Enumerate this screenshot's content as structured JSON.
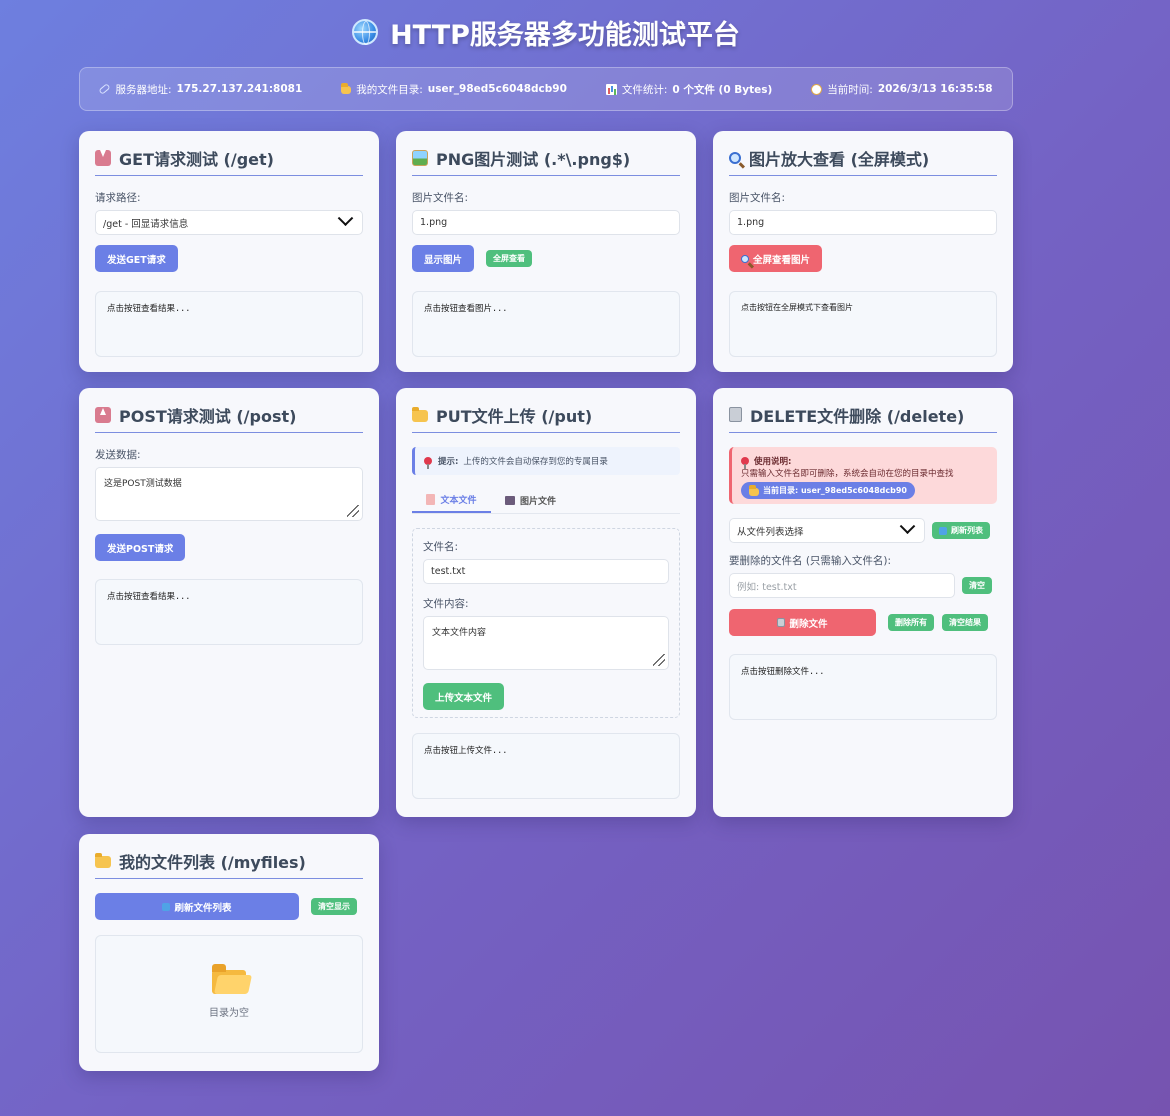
{
  "page_title": "HTTP服务器多功能测试平台",
  "info": {
    "server_label": "服务器地址:",
    "server_value": "175.27.137.241:8081",
    "dir_label": "我的文件目录:",
    "dir_value": "user_98ed5c6048dcb90",
    "stats_label": "文件统计:",
    "stats_value": "0 个文件 (0 Bytes)",
    "time_label": "当前时间:",
    "time_value": "2026/3/13 16:35:58"
  },
  "get_card": {
    "title": "GET请求测试 (/get)",
    "path_label": "请求路径:",
    "path_selected": "/get - 回显请求信息",
    "send_button": "发送GET请求",
    "result": "点击按钮查看结果..."
  },
  "png_card": {
    "title": "PNG图片测试 (.*\\.png$)",
    "file_label": "图片文件名:",
    "file_value": "1.png",
    "show_button": "显示图片",
    "fullscreen_button": "全屏查看",
    "result": "点击按钮查看图片..."
  },
  "zoom_card": {
    "title": "图片放大查看 (全屏模式)",
    "file_label": "图片文件名:",
    "file_value": "1.png",
    "fullscreen_button": "全屏查看图片",
    "result": "点击按钮在全屏模式下查看图片"
  },
  "post_card": {
    "title": "POST请求测试 (/post)",
    "data_label": "发送数据:",
    "data_value": "这是POST测试数据",
    "send_button": "发送POST请求",
    "result": "点击按钮查看结果..."
  },
  "put_card": {
    "title": "PUT文件上传 (/put)",
    "hint_label": "提示:",
    "hint_text": "上传的文件会自动保存到您的专属目录",
    "tab_text": "文本文件",
    "tab_image": "图片文件",
    "filename_label": "文件名:",
    "filename_value": "test.txt",
    "content_label": "文件内容:",
    "content_value": "文本文件内容",
    "upload_button": "上传文本文件",
    "result": "点击按钮上传文件..."
  },
  "delete_card": {
    "title": "DELETE文件删除 (/delete)",
    "warn_title": "使用说明:",
    "warn_text": "只需输入文件名即可删除，系统会自动在您的目录中查找",
    "current_dir": "当前目录: user_98ed5c6048dcb90",
    "select_placeholder": "从文件列表选择",
    "refresh_button": "刷新列表",
    "filename_label": "要删除的文件名 (只需输入文件名):",
    "filename_placeholder": "例如: test.txt",
    "clear_button": "清空",
    "delete_button": "删除文件",
    "delete_all_button": "删除所有",
    "clear_result_button": "清空结果",
    "result": "点击按钮删除文件..."
  },
  "myfiles_card": {
    "title": "我的文件列表 (/myfiles)",
    "refresh_button": "刷新文件列表",
    "clear_button": "清空显示",
    "empty_text": "目录为空"
  }
}
